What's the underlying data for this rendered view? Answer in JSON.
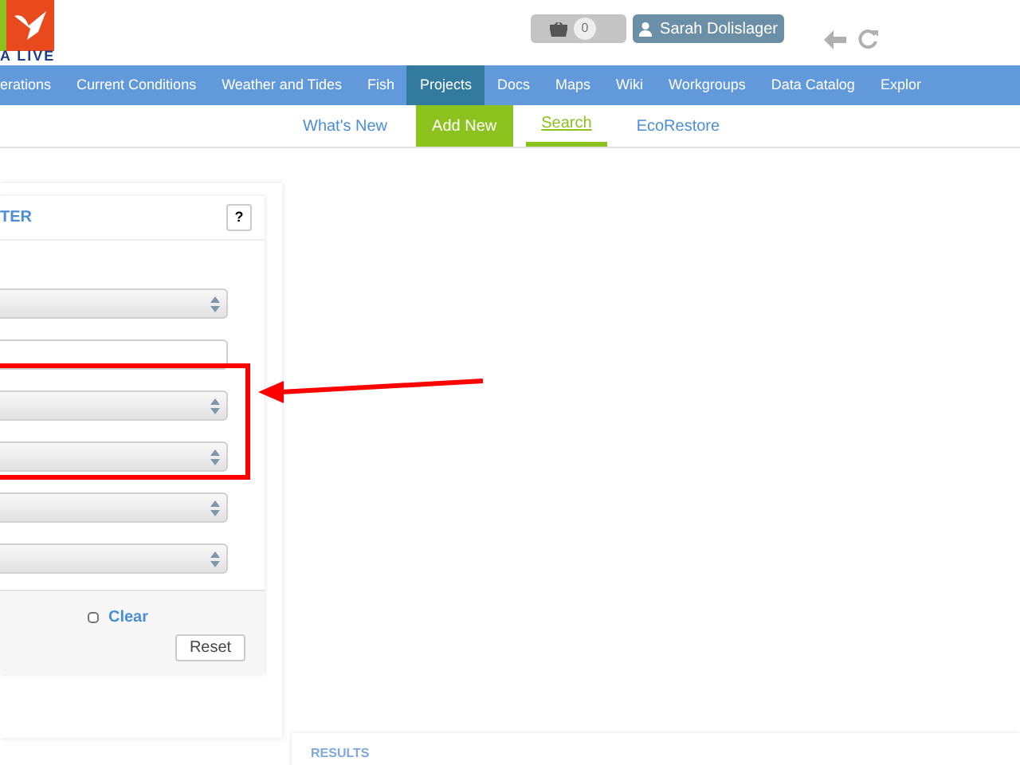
{
  "header": {
    "logo_text": "A LIVE",
    "basket_count": "0",
    "user": "Sarah Dolislager"
  },
  "nav": [
    {
      "label": "erations",
      "selected": false
    },
    {
      "label": "Current Conditions",
      "selected": false
    },
    {
      "label": "Weather and Tides",
      "selected": false
    },
    {
      "label": "Fish",
      "selected": false
    },
    {
      "label": "Projects",
      "selected": true
    },
    {
      "label": "Docs",
      "selected": false
    },
    {
      "label": "Maps",
      "selected": false
    },
    {
      "label": "Wiki",
      "selected": false
    },
    {
      "label": "Workgroups",
      "selected": false
    },
    {
      "label": "Data Catalog",
      "selected": false
    },
    {
      "label": "Explor",
      "selected": false
    }
  ],
  "subnav": [
    {
      "label": "What's New",
      "kind": "plain"
    },
    {
      "label": "Add New",
      "kind": "filled"
    },
    {
      "label": "Search",
      "kind": "current"
    },
    {
      "label": "EcoRestore",
      "kind": "plain"
    }
  ],
  "filter": {
    "title": "TER",
    "help": "?",
    "fields": [
      {
        "kind": "select"
      },
      {
        "kind": "input"
      },
      {
        "kind": "select"
      },
      {
        "kind": "select"
      },
      {
        "kind": "select"
      },
      {
        "kind": "select"
      }
    ],
    "clear": {
      "label": "Clear",
      "checked": false
    },
    "reset": "Reset"
  },
  "results": {
    "title": "RESULTS"
  }
}
